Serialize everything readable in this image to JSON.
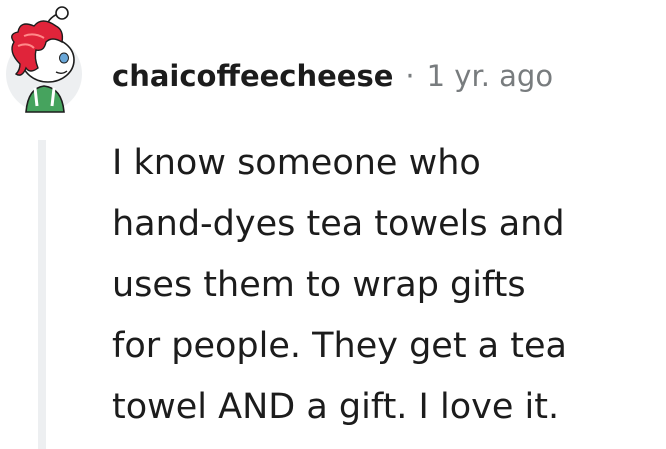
{
  "comment": {
    "author": {
      "username": "chaicoffeecheese",
      "avatar_icon": "snoo-avatar-icon"
    },
    "separator": "·",
    "timestamp": "1 yr. ago",
    "body_lines": [
      "I know someone who",
      "hand-dyes tea towels and",
      "uses them to wrap gifts",
      "for people. They get a tea",
      "towel AND a gift. I love it."
    ]
  },
  "colors": {
    "text_primary": "#1c1c1c",
    "text_meta": "#787c7e",
    "thread_line": "#edeff1",
    "avatar_background": "#edeff1",
    "avatar_hair": "#e0243a",
    "avatar_shirt": "#46a35e"
  }
}
